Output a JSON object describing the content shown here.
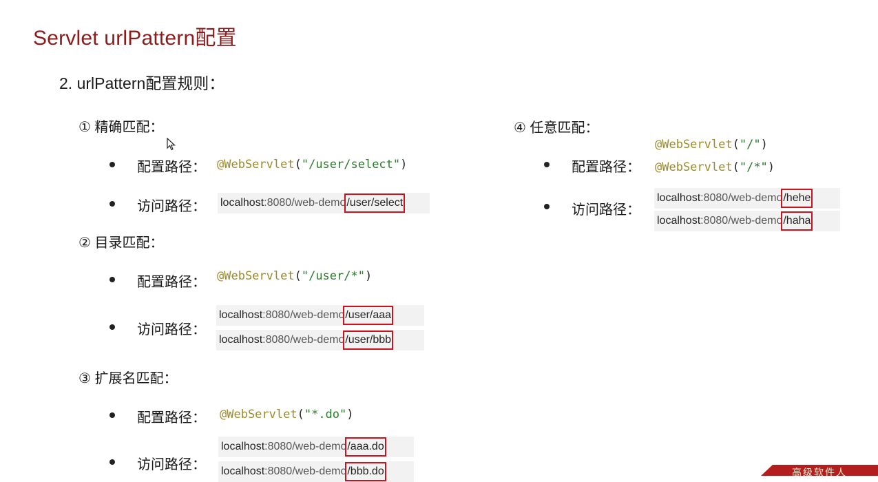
{
  "title": "Servlet urlPattern配置",
  "subtitle": "2. urlPattern配置规则：",
  "config_label": "配置路径：",
  "access_label": "访问路径：",
  "sections": {
    "exact": {
      "head": "① 精确匹配：",
      "annotation": "@WebServlet",
      "open": "(",
      "string": "\"/user/select\"",
      "close": ")",
      "urls": [
        {
          "host": "localhost",
          "mid": ":8080/web-demo",
          "hl": "/user/select"
        }
      ]
    },
    "dir": {
      "head": "② 目录匹配：",
      "annotation": "@WebServlet",
      "open": "(",
      "string": "\"/user/*\"",
      "close": ")",
      "urls": [
        {
          "host": "localhost",
          "mid": ":8080/web-demo",
          "hl": "/user/aaa"
        },
        {
          "host": "localhost",
          "mid": ":8080/web-demo",
          "hl": "/user/bbb"
        }
      ]
    },
    "ext": {
      "head": "③ 扩展名匹配：",
      "annotation": "@WebServlet",
      "open": "(",
      "string": "\"*.do\"",
      "close": ")",
      "urls": [
        {
          "host": "localhost",
          "mid": ":8080/web-demo",
          "hl": "/aaa.do"
        },
        {
          "host": "localhost",
          "mid": ":8080/web-demo",
          "hl": "/bbb.do"
        }
      ]
    },
    "any": {
      "head": "④ 任意匹配：",
      "annotation": "@WebServlet",
      "open": "(",
      "string1": "\"/\"",
      "string2": "\"/*\"",
      "close": ")",
      "urls": [
        {
          "host": "localhost",
          "mid": ":8080/web-demo",
          "hl": "/hehe"
        },
        {
          "host": "localhost",
          "mid": ":8080/web-demo",
          "hl": "/haha"
        }
      ]
    }
  },
  "brand_text": "高级软件人"
}
